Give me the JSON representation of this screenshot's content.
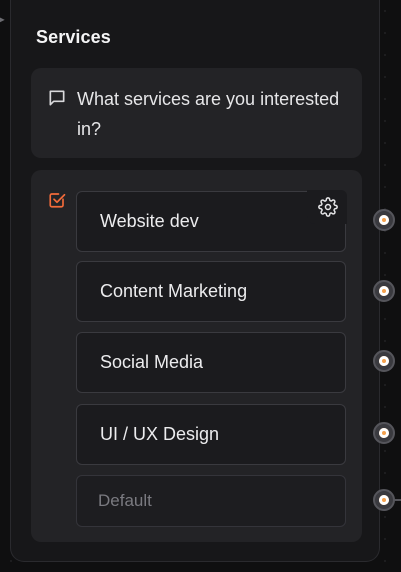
{
  "node": {
    "title": "Services",
    "question": "What services are you interested in?",
    "choices": [
      {
        "label": "Website dev"
      },
      {
        "label": "Content Marketing"
      },
      {
        "label": "Social Media"
      },
      {
        "label": "UI / UX Design"
      }
    ],
    "default_placeholder": "Default"
  },
  "icons": {
    "question": "message-square-icon",
    "choices": "checkbox-icon",
    "settings": "gear-icon",
    "port": "output-port"
  },
  "colors": {
    "background": "#0f0f10",
    "node_bg": "#171719",
    "card_bg": "#232326",
    "accent": "#f36b3a",
    "port": "#f6a24e"
  }
}
